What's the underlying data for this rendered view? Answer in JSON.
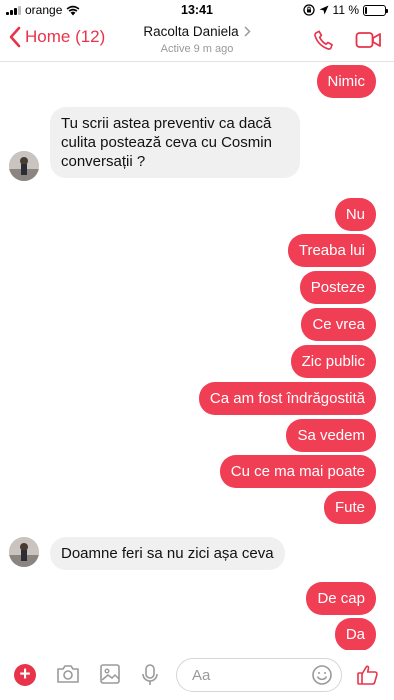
{
  "status_bar": {
    "carrier": "orange",
    "time": "13:41",
    "battery": "11 %",
    "battery_level": 0.11
  },
  "header": {
    "back_label": "Home (12)",
    "contact_name": "Racolta Daniela",
    "status": "Active 9 m ago"
  },
  "messages": {
    "m1": "Nimic",
    "m2": "Tu scrii astea preventiv ca dacă culita postează ceva cu Cosmin conversații ?",
    "m3": "Nu",
    "m4": "Treaba lui",
    "m5": "Posteze",
    "m6": "Ce vrea",
    "m7": "Zic public",
    "m8": "Ca am fost îndrăgostită",
    "m9": "Sa vedem",
    "m10": "Cu ce ma mai poate",
    "m11": "Fute",
    "m12": "Doamne feri sa nu zici așa ceva",
    "m13": "De cap",
    "m14": "Da"
  },
  "composer": {
    "placeholder": "Aa"
  },
  "colors": {
    "accent": "#e8344a",
    "bubble_out": "#f03e55",
    "bubble_in": "#f0f0f0"
  }
}
